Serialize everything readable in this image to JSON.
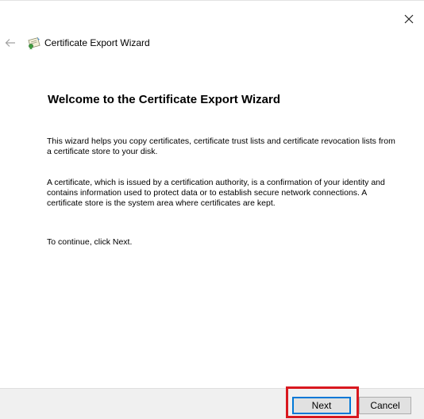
{
  "window": {
    "close_glyph": "✕"
  },
  "header": {
    "back_icon": "back-arrow-icon",
    "wizard_icon": "certificate-icon",
    "title": "Certificate Export Wizard"
  },
  "content": {
    "heading": "Welcome to the Certificate Export Wizard",
    "paragraph1": "This wizard helps you copy certificates, certificate trust lists and certificate revocation lists from a certificate store to your disk.",
    "paragraph2": "A certificate, which is issued by a certification authority, is a confirmation of your identity and contains information used to protect data or to establish secure network connections. A certificate store is the system area where certificates are kept.",
    "paragraph3": "To continue, click Next."
  },
  "footer": {
    "next_label": "Next",
    "cancel_label": "Cancel"
  },
  "colors": {
    "highlight": "#d9181f",
    "focus_border": "#0078d7",
    "footer_bg": "#f0f0f0"
  }
}
